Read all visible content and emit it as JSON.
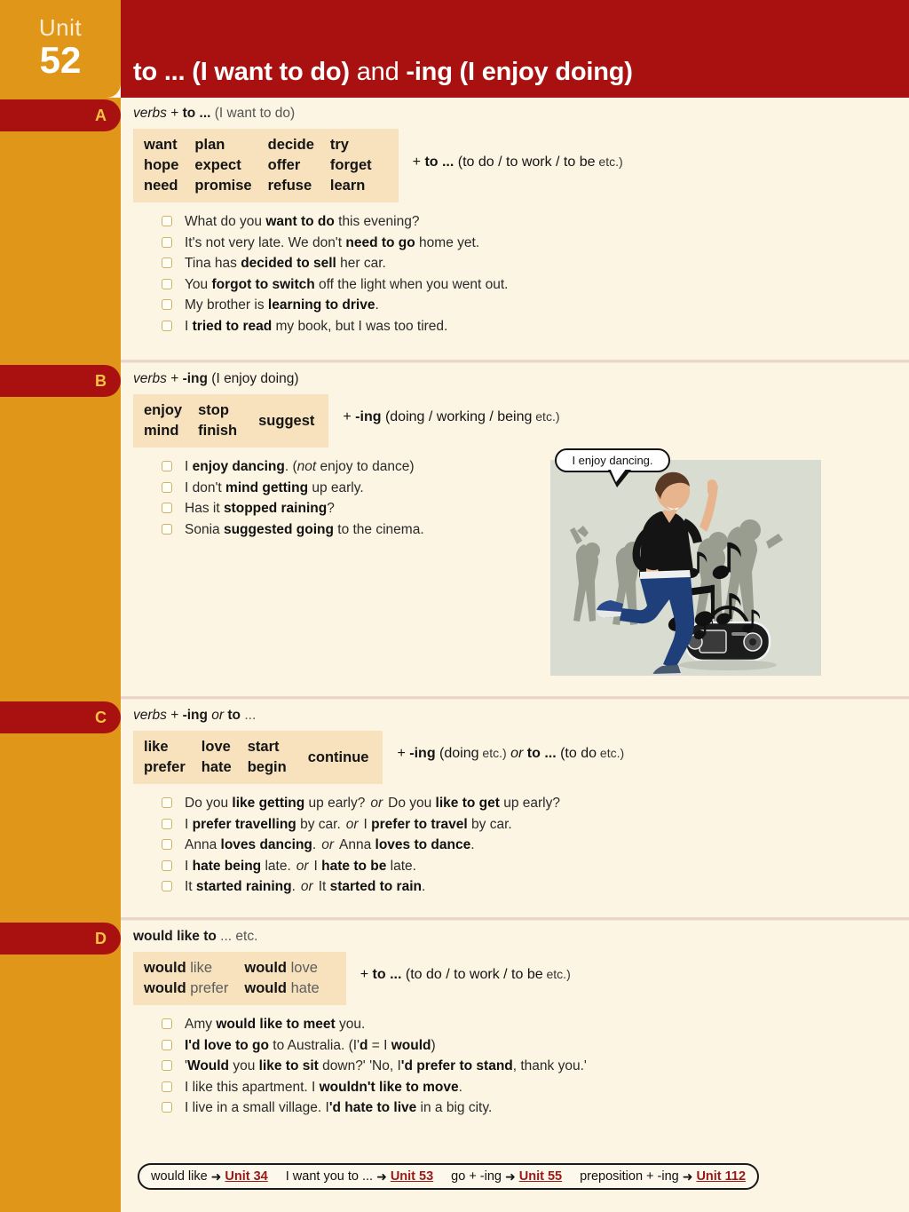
{
  "unit": {
    "word": "Unit",
    "number": "52"
  },
  "header": {
    "title_part1": "to ... (I want to do)",
    "title_and": " and ",
    "title_part2": "-ing (I enjoy doing)",
    "title_full": "to ... (I want to do) and -ing (I enjoy doing)"
  },
  "sections": [
    {
      "letter": "A",
      "heading_italic": "verbs",
      "heading_rest": " + ",
      "heading_bold": "to ...",
      "heading_tail": " (I want to do)",
      "verbs": [
        [
          "want",
          "plan",
          "decide",
          "try"
        ],
        [
          "hope",
          "expect",
          "offer",
          "forget"
        ],
        [
          "need",
          "promise",
          "refuse",
          "learn"
        ]
      ],
      "formula_plus": "+ ",
      "formula_bold": "to ...",
      "formula_rest": " (to do / to work / to be",
      "formula_etc": " etc.)",
      "examples": [
        [
          {
            "t": "What do you ",
            "w": "n"
          },
          {
            "t": "want to do",
            "w": "b"
          },
          {
            "t": " this evening?",
            "w": "n"
          }
        ],
        [
          {
            "t": "It's not very late. We don't ",
            "w": "n"
          },
          {
            "t": "need to go",
            "w": "b"
          },
          {
            "t": " home yet.",
            "w": "n"
          }
        ],
        [
          {
            "t": "Tina has ",
            "w": "n"
          },
          {
            "t": "decided to sell",
            "w": "b"
          },
          {
            "t": " her car.",
            "w": "n"
          }
        ],
        [
          {
            "t": "You ",
            "w": "n"
          },
          {
            "t": "forgot to switch",
            "w": "b"
          },
          {
            "t": " off the light when you went out.",
            "w": "n"
          }
        ],
        [
          {
            "t": "My brother is ",
            "w": "n"
          },
          {
            "t": "learning to drive",
            "w": "b"
          },
          {
            "t": ".",
            "w": "n"
          }
        ],
        [
          {
            "t": "I ",
            "w": "n"
          },
          {
            "t": "tried to read",
            "w": "b"
          },
          {
            "t": " my book, but I was too tired.",
            "w": "n"
          }
        ]
      ]
    },
    {
      "letter": "B",
      "heading_italic": "verbs",
      "heading_rest": " + ",
      "heading_bold": "-ing",
      "heading_tail": " (I enjoy doing)",
      "verbs": [
        [
          "enjoy",
          "stop"
        ],
        [
          "mind",
          "finish"
        ]
      ],
      "verb_merged": "suggest",
      "formula_plus": "+ ",
      "formula_bold": "-ing",
      "formula_rest": " (doing / working / being",
      "formula_etc": " etc.)",
      "examples": [
        [
          {
            "t": "I ",
            "w": "n"
          },
          {
            "t": "enjoy dancing",
            "w": "b"
          },
          {
            "t": ".   (",
            "w": "n"
          },
          {
            "t": "not",
            "w": "i"
          },
          {
            "t": " enjoy to dance)",
            "w": "n"
          }
        ],
        [
          {
            "t": "I don't ",
            "w": "n"
          },
          {
            "t": "mind getting",
            "w": "b"
          },
          {
            "t": " up early.",
            "w": "n"
          }
        ],
        [
          {
            "t": "Has it ",
            "w": "n"
          },
          {
            "t": "stopped raining",
            "w": "b"
          },
          {
            "t": "?",
            "w": "n"
          }
        ],
        [
          {
            "t": "Sonia ",
            "w": "n"
          },
          {
            "t": "suggested going",
            "w": "b"
          },
          {
            "t": " to the cinema.",
            "w": "n"
          }
        ]
      ],
      "illustration": {
        "speech_bubble": "I enjoy dancing.",
        "description": "man dancing with silhouettes, music notes and boombox"
      }
    },
    {
      "letter": "C",
      "heading_italic": "verbs",
      "heading_rest": " + ",
      "heading_bold": "-ing",
      "heading_or": " or ",
      "heading_bold2": "to",
      "heading_tail": " ...",
      "verbs": [
        [
          "like",
          "love",
          "start"
        ],
        [
          "prefer",
          "hate",
          "begin"
        ]
      ],
      "verb_merged": "continue",
      "formula_plus": "+ ",
      "formula_bold": "-ing",
      "formula_rest": " (doing",
      "formula_etc": " etc.)",
      "formula_or": " or ",
      "formula_bold2": "to ...",
      "formula_rest2": " (to do",
      "formula_etc2": " etc.)",
      "examples": [
        [
          {
            "t": "Do you ",
            "w": "n"
          },
          {
            "t": "like getting",
            "w": "b"
          },
          {
            "t": " up early?",
            "w": "n"
          },
          {
            "t": "or",
            "w": "or"
          },
          {
            "t": "Do you ",
            "w": "n"
          },
          {
            "t": "like to get",
            "w": "b"
          },
          {
            "t": " up early?",
            "w": "n"
          }
        ],
        [
          {
            "t": "I ",
            "w": "n"
          },
          {
            "t": "prefer travelling",
            "w": "b"
          },
          {
            "t": " by car.",
            "w": "n"
          },
          {
            "t": "or",
            "w": "or"
          },
          {
            "t": "I ",
            "w": "n"
          },
          {
            "t": "prefer to travel",
            "w": "b"
          },
          {
            "t": " by car.",
            "w": "n"
          }
        ],
        [
          {
            "t": "Anna ",
            "w": "n"
          },
          {
            "t": "loves dancing",
            "w": "b"
          },
          {
            "t": ".",
            "w": "n"
          },
          {
            "t": "or",
            "w": "or"
          },
          {
            "t": "Anna ",
            "w": "n"
          },
          {
            "t": "loves to dance",
            "w": "b"
          },
          {
            "t": ".",
            "w": "n"
          }
        ],
        [
          {
            "t": "I ",
            "w": "n"
          },
          {
            "t": "hate being",
            "w": "b"
          },
          {
            "t": " late.",
            "w": "n"
          },
          {
            "t": "or",
            "w": "or"
          },
          {
            "t": "I ",
            "w": "n"
          },
          {
            "t": "hate to be",
            "w": "b"
          },
          {
            "t": " late.",
            "w": "n"
          }
        ],
        [
          {
            "t": "It ",
            "w": "n"
          },
          {
            "t": "started raining",
            "w": "b"
          },
          {
            "t": ".",
            "w": "n"
          },
          {
            "t": "or",
            "w": "or"
          },
          {
            "t": "It ",
            "w": "n"
          },
          {
            "t": "started to rain",
            "w": "b"
          },
          {
            "t": ".",
            "w": "n"
          }
        ]
      ]
    },
    {
      "letter": "D",
      "heading_bold": "would like to",
      "heading_tail": " ... etc.",
      "verbs_pairs": [
        [
          {
            "bold": "would",
            "light": "like"
          },
          {
            "bold": "would",
            "light": "love"
          }
        ],
        [
          {
            "bold": "would",
            "light": "prefer"
          },
          {
            "bold": "would",
            "light": "hate"
          }
        ]
      ],
      "formula_plus": "+ ",
      "formula_bold": "to ...",
      "formula_rest": " (to do / to work / to be",
      "formula_etc": " etc.)",
      "examples": [
        [
          {
            "t": "Amy ",
            "w": "n"
          },
          {
            "t": "would like to meet",
            "w": "b"
          },
          {
            "t": " you.",
            "w": "n"
          }
        ],
        [
          {
            "t": "I'd love to go",
            "w": "b"
          },
          {
            "t": " to Australia.  (I'",
            "w": "n"
          },
          {
            "t": "d",
            "w": "b"
          },
          {
            "t": " = I ",
            "w": "n"
          },
          {
            "t": "would",
            "w": "b"
          },
          {
            "t": ")",
            "w": "n"
          }
        ],
        [
          {
            "t": "'",
            "w": "n"
          },
          {
            "t": "Would",
            "w": "b"
          },
          {
            "t": " you ",
            "w": "n"
          },
          {
            "t": "like to sit",
            "w": "b"
          },
          {
            "t": " down?'    'No, I",
            "w": "n"
          },
          {
            "t": "'d prefer to stand",
            "w": "b"
          },
          {
            "t": ", thank you.'",
            "w": "n"
          }
        ],
        [
          {
            "t": "I like this apartment.  I ",
            "w": "n"
          },
          {
            "t": "wouldn't like to move",
            "w": "b"
          },
          {
            "t": ".",
            "w": "n"
          }
        ],
        [
          {
            "t": "I live in a small village.  I",
            "w": "n"
          },
          {
            "t": "'d hate to live",
            "w": "b"
          },
          {
            "t": " in a big city.",
            "w": "n"
          }
        ]
      ]
    }
  ],
  "footer_refs": [
    {
      "label": "would like",
      "arrow": "➜",
      "unit": "Unit 34"
    },
    {
      "label": "I want you to ...",
      "arrow": "➜",
      "unit": "Unit 53"
    },
    {
      "label": "go + -ing",
      "arrow": "➜",
      "unit": "Unit 55"
    },
    {
      "label": "preposition + -ing",
      "arrow": "➜",
      "unit": "Unit 112"
    }
  ],
  "colors": {
    "red": "#a8110f",
    "orange": "#e09719",
    "page_bg": "#fdf8ec",
    "panel_bg": "#fdf5e3",
    "verbbox_bg": "#f7e2bd",
    "tab_letter": "#f6c343",
    "link_red": "#9a1818"
  }
}
